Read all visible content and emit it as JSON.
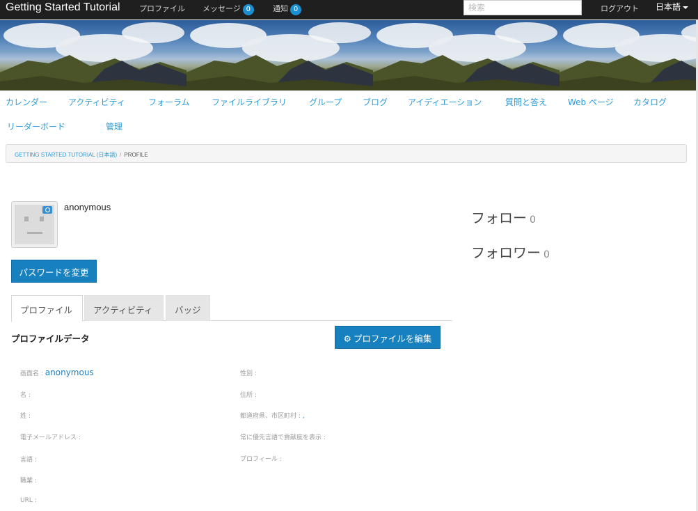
{
  "topbar": {
    "title": "Getting Started Tutorial",
    "profile_link": "プロファイル",
    "messages_label": "メッセージ",
    "messages_count": "0",
    "notifications_label": "通知",
    "notifications_count": "0",
    "search_placeholder": "検索",
    "logout": "ログアウト",
    "language": "日本語"
  },
  "subnav": {
    "items": [
      "カレンダー",
      "アクティビティ",
      "フォーラム",
      "ファイルライブラリ",
      "グループ",
      "ブログ",
      "アイディエーション",
      "質問と答え",
      "Web ページ",
      "カタログ",
      "リーダーボード",
      "管理"
    ]
  },
  "breadcrumb": {
    "parent": "GETTING STARTED TUTORIAL (日本語)",
    "separator": "/",
    "current": "PROFILE"
  },
  "profile": {
    "username": "anonymous",
    "change_password": "パスワードを変更",
    "following_label": "フォロー",
    "following_count": "0",
    "followers_label": "フォロワー",
    "followers_count": "0"
  },
  "tabs": [
    "プロファイル",
    "アクティビティ",
    "バッジ"
  ],
  "profile_data": {
    "title": "プロファイルデータ",
    "edit_button": "プロファイルを編集",
    "left_fields": [
      {
        "label": "画面名 :",
        "value": "anonymous"
      },
      {
        "label": "名 :",
        "value": ""
      },
      {
        "label": "姓 :",
        "value": ""
      },
      {
        "label": "電子メールアドレス :",
        "value": ""
      },
      {
        "label": "言語 :",
        "value": ""
      },
      {
        "label": "職業 :",
        "value": ""
      },
      {
        "label": "URL :",
        "value": ""
      }
    ],
    "right_fields": [
      {
        "label": "性別 :",
        "value": ""
      },
      {
        "label": "住所 :",
        "value": ""
      },
      {
        "label": "都道府県、市区町村 :",
        "value": ","
      },
      {
        "label": "常に優先言語で貢献度を表示 :",
        "value": ""
      },
      {
        "label": "プロフィール :",
        "value": ""
      }
    ]
  },
  "colors": {
    "topbar": "#1f1f1f",
    "link": "#2c9ad6",
    "button": "#1780bf",
    "badge": "#1a8fd1"
  }
}
